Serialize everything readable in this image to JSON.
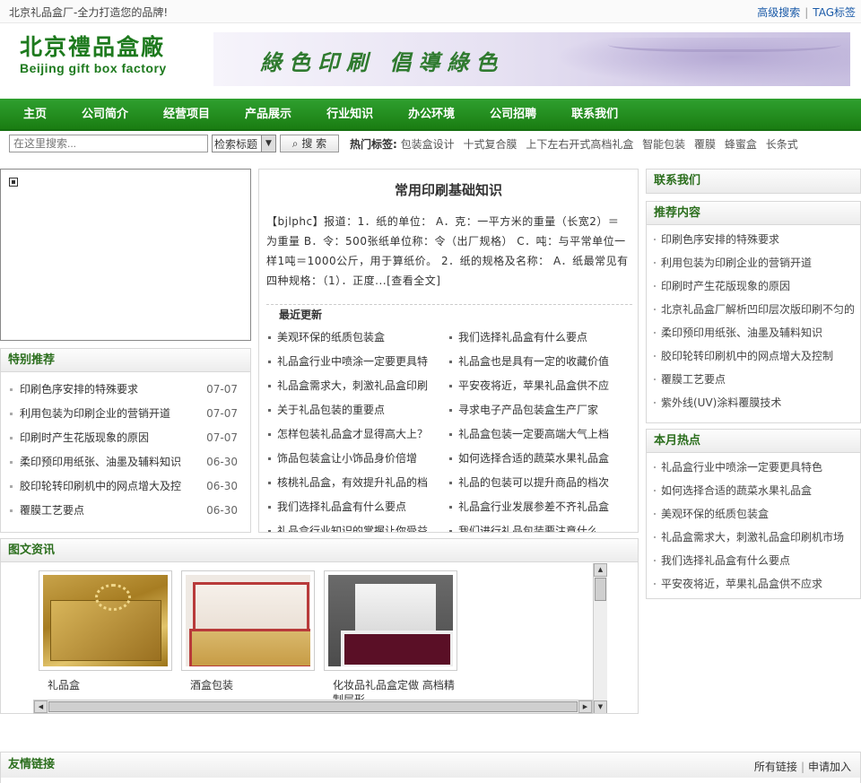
{
  "topbar": {
    "slogan": "北京礼品盒厂-全力打造您的品牌!",
    "advanced_search": "高级搜索",
    "separator": "|",
    "tag_label": "TAG标签"
  },
  "logo": {
    "cn": "北京禮品盒廠",
    "en": "Beijing gift box factory"
  },
  "banner": {
    "text": "綠色印刷 倡導綠色"
  },
  "nav": [
    "主页",
    "公司简介",
    "经营项目",
    "产品展示",
    "行业知识",
    "办公环境",
    "公司招聘",
    "联系我们"
  ],
  "search": {
    "placeholder": "在这里搜索...",
    "select_value": "检索标题",
    "button": "搜 索",
    "hot_label": "热门标签:",
    "hot_tags": [
      "包装盒设计",
      "十式复合膜",
      "上下左右开式高档礼盒",
      "智能包装",
      "覆膜",
      "蜂蜜盒",
      "长条式"
    ]
  },
  "special": {
    "title": "特别推荐",
    "items": [
      {
        "title": "印刷色序安排的特殊要求",
        "date": "07-07"
      },
      {
        "title": "利用包装为印刷企业的营销开道",
        "date": "07-07"
      },
      {
        "title": "印刷时产生花版现象的原因",
        "date": "07-07"
      },
      {
        "title": "柔印预印用纸张、油墨及辅料知识",
        "date": "06-30"
      },
      {
        "title": "胶印轮转印刷机中的网点增大及控",
        "date": "06-30"
      },
      {
        "title": "覆膜工艺要点",
        "date": "06-30"
      }
    ]
  },
  "article": {
    "title": "常用印刷基础知识",
    "summary": "【bjlphc】报道：1．纸的单位： A．克：一平方米的重量（长宽2）＝为重量 B．令：500张纸单位称：令（出厂规格） C．吨：与平常单位一样1吨＝1000公斤，用于算纸价。 2．纸的规格及名称： A．纸最常见有四种规格：（1）．正度...",
    "more": "[查看全文]",
    "latest_label": "最近更新",
    "latest": [
      "美观环保的纸质包装盒",
      "我们选择礼品盒有什么要点",
      "礼品盒行业中喷涂一定要更具特",
      "礼品盒也是具有一定的收藏价值",
      "礼品盒需求大，刺激礼品盒印刷",
      "平安夜将近，苹果礼品盒供不应",
      "关于礼品包装的重要点",
      "寻求电子产品包装盒生产厂家",
      "怎样包装礼品盒才显得高大上？",
      "礼品盒包装一定要高端大气上档",
      "饰品包装盒让小饰品身价倍增",
      "如何选择合适的蔬菜水果礼品盒",
      "核桃礼品盒，有效提升礼品的档",
      "礼品的包装可以提升商品的档次",
      "我们选择礼品盒有什么要点",
      "礼品盒行业发展参差不齐礼品盒",
      "礼品盒行业知识的掌握让你受益",
      "我们进行礼品包装要注意什么"
    ]
  },
  "pics": {
    "title": "图文资讯",
    "items": [
      {
        "caption": "礼品盒",
        "image": "gold-gift-box"
      },
      {
        "caption": "酒盒包装",
        "image": "wine-box"
      },
      {
        "caption": "化妆品礼品盒定做 高档精制层形",
        "image": "cosmetic-box"
      }
    ]
  },
  "contact": {
    "title": "联系我们"
  },
  "recommend": {
    "title": "推荐内容",
    "items": [
      "印刷色序安排的特殊要求",
      "利用包装为印刷企业的营销开道",
      "印刷时产生花版现象的原因",
      "北京礼品盒厂解析凹印层次版印刷不匀的",
      "柔印预印用纸张、油墨及辅料知识",
      "胶印轮转印刷机中的网点增大及控制",
      "覆膜工艺要点",
      "紫外线(UV)涂料覆膜技术"
    ]
  },
  "hot": {
    "title": "本月热点",
    "items": [
      "礼品盒行业中喷涂一定要更具特色",
      "如何选择合适的蔬菜水果礼品盒",
      "美观环保的纸质包装盒",
      "礼品盒需求大，刺激礼品盒印刷机市场",
      "我们选择礼品盒有什么要点",
      "平安夜将近，苹果礼品盒供不应求"
    ]
  },
  "friends": {
    "title": "友情链接",
    "all_links": "所有链接",
    "separator": "|",
    "apply": "申请加入"
  },
  "colors": {
    "brand_green": "#1e7a1e",
    "nav_green": "#2fa02f",
    "link_blue": "#1a5aa8"
  }
}
